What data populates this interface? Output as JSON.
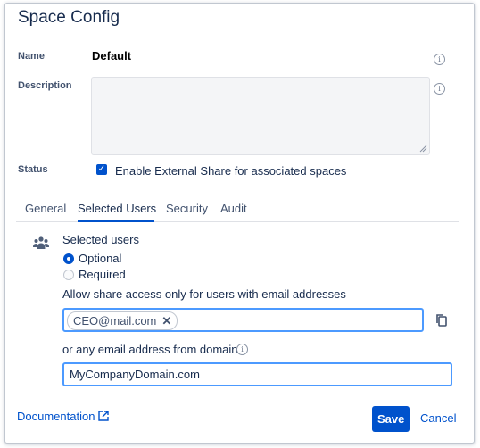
{
  "dialog": {
    "title": "Space Config"
  },
  "fields": {
    "name_label": "Name",
    "name_value": "Default",
    "description_label": "Description",
    "description_value": "",
    "status_label": "Status",
    "status_checkbox_label": "Enable External Share for associated spaces",
    "status_checked": true
  },
  "tabs": [
    {
      "label": "General",
      "active": false
    },
    {
      "label": "Selected Users",
      "active": true
    },
    {
      "label": "Security",
      "active": false
    },
    {
      "label": "Audit",
      "active": false
    }
  ],
  "selected_users": {
    "heading": "Selected users",
    "options": [
      {
        "label": "Optional",
        "selected": true
      },
      {
        "label": "Required",
        "selected": false
      }
    ],
    "email_label": "Allow share access only for users with email addresses",
    "emails": [
      "CEO@mail.com"
    ],
    "domain_label": "or any email address from domain",
    "domain_value": "MyCompanyDomain.com"
  },
  "footer": {
    "documentation_link": "Documentation",
    "save_label": "Save",
    "cancel_label": "Cancel"
  },
  "colors": {
    "primary": "#0052cc",
    "focus_border": "#4c9aff",
    "text": "#172b4d"
  },
  "icons": {
    "info": "info-circle-icon",
    "users": "users-group-icon",
    "copy": "copy-icon",
    "external": "external-link-icon",
    "remove": "close-icon"
  }
}
